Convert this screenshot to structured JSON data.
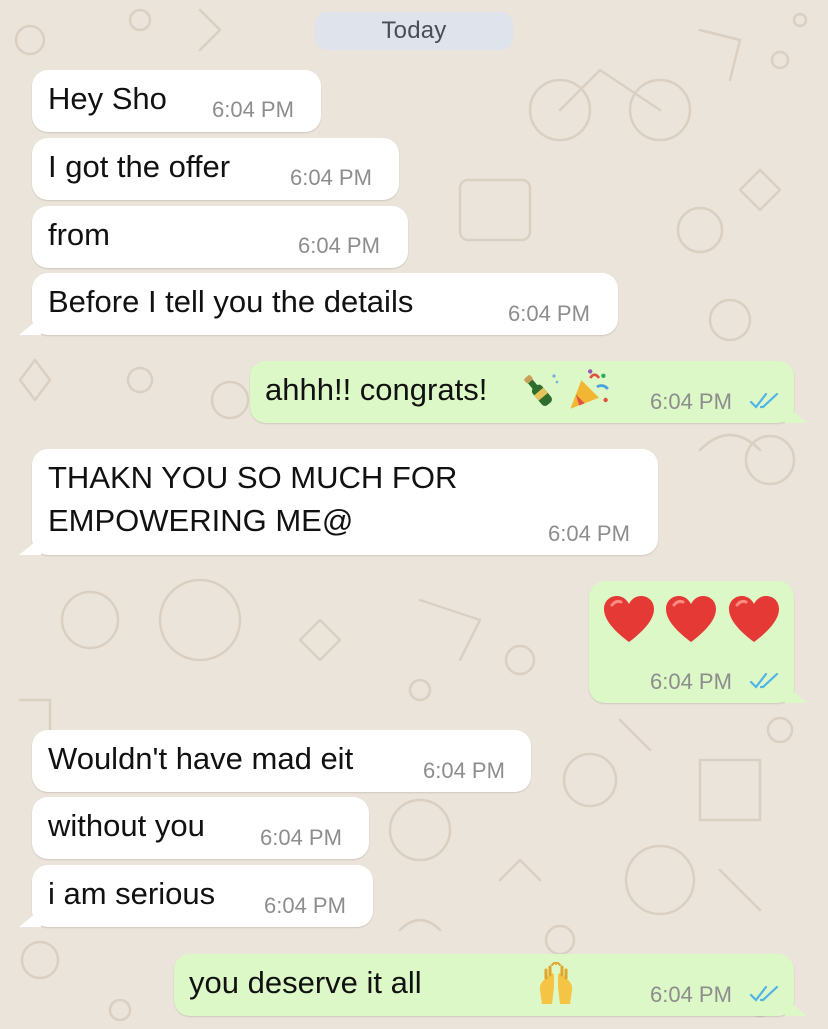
{
  "date_separator": "Today",
  "colors": {
    "wallpaper": "#ebe4da",
    "incoming_bubble": "#ffffff",
    "outgoing_bubble": "#dcf8c6",
    "read_ticks": "#4fb3e8",
    "timestamp": "#8d8d8d"
  },
  "messages": [
    {
      "direction": "incoming",
      "text": "Hey Sho",
      "time": "6:04 PM"
    },
    {
      "direction": "incoming",
      "text": "I got the offer",
      "time": "6:04 PM"
    },
    {
      "direction": "incoming",
      "text": "from",
      "time": "6:04 PM"
    },
    {
      "direction": "incoming",
      "text": "Before I tell you the details",
      "time": "6:04 PM"
    },
    {
      "direction": "outgoing",
      "text": "ahhh!! congrats!",
      "emoji": [
        "bottle-with-popping-cork-icon",
        "party-popper-icon"
      ],
      "time": "6:04 PM",
      "status": "read"
    },
    {
      "direction": "incoming",
      "lines": [
        "THAKN YOU SO MUCH FOR",
        "EMPOWERING ME@"
      ],
      "time": "6:04 PM"
    },
    {
      "direction": "outgoing",
      "emoji": [
        "red-heart-icon",
        "red-heart-icon",
        "red-heart-icon"
      ],
      "time": "6:04 PM",
      "status": "read"
    },
    {
      "direction": "incoming",
      "text": "Wouldn't have mad eit",
      "time": "6:04 PM"
    },
    {
      "direction": "incoming",
      "text": "without you",
      "time": "6:04 PM"
    },
    {
      "direction": "incoming",
      "text": "i am serious",
      "time": "6:04 PM"
    },
    {
      "direction": "outgoing",
      "text": "you deserve it all",
      "emoji": [
        "raising-hands-icon"
      ],
      "time": "6:04 PM",
      "status": "read"
    }
  ]
}
